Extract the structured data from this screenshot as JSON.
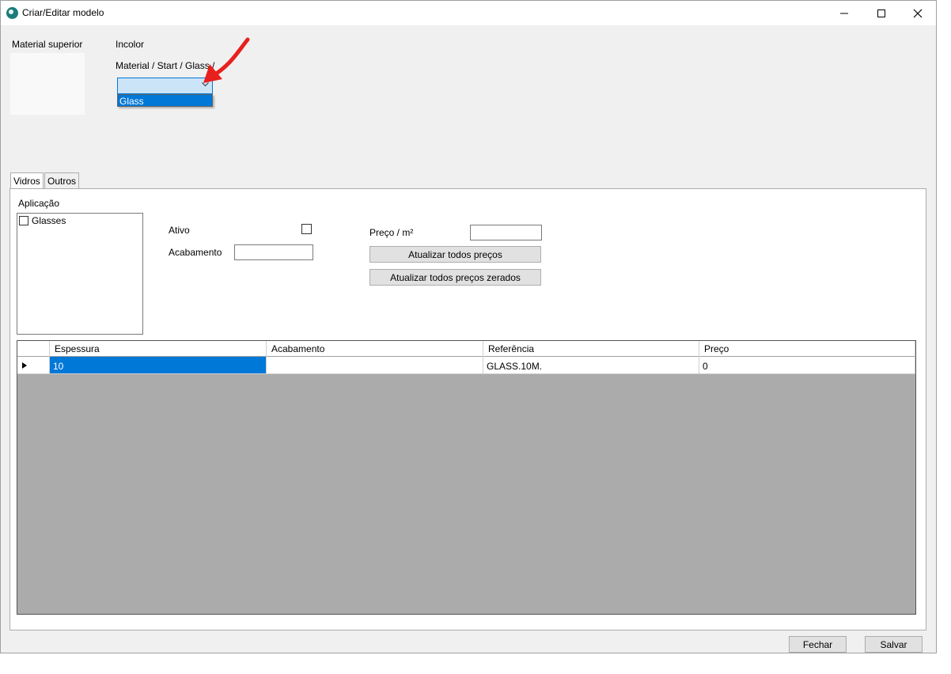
{
  "window": {
    "title": "Criar/Editar modelo",
    "controls": {
      "minimize": "—",
      "maximize": "☐",
      "close": "✕"
    }
  },
  "top": {
    "material_superior_label": "Material superior",
    "color_label": "Incolor",
    "path_label": "Material / Start / Glass /",
    "combo": {
      "value": "",
      "open": true,
      "options": [
        "Glass"
      ],
      "highlighted": "Glass"
    }
  },
  "tabs": [
    {
      "label": "Vidros",
      "active": true
    },
    {
      "label": "Outros",
      "active": false
    }
  ],
  "vidros": {
    "aplicacao_label": "Aplicação",
    "aplicacao_items": [
      {
        "label": "Glasses",
        "checked": false
      }
    ],
    "ativo_label": "Ativo",
    "ativo_checked": false,
    "acabamento_label": "Acabamento",
    "acabamento_value": "",
    "preco_label": "Preço / m²",
    "preco_value": "",
    "btn_update_all": "Atualizar todos preços",
    "btn_update_zero": "Atualizar todos preços zerados"
  },
  "grid": {
    "columns": [
      "Espessura",
      "Acabamento",
      "Referência",
      "Preço"
    ],
    "rows": [
      [
        "10",
        "",
        "GLASS.10M.",
        "0"
      ]
    ],
    "current_row_marker": "▶"
  },
  "footer": {
    "fechar": "Fechar",
    "salvar": "Salvar"
  },
  "colors": {
    "accent": "#0078d7",
    "annotation_arrow": "#e8201e",
    "window_bg": "#f0f0f0",
    "grid_empty_bg": "#ababab"
  }
}
